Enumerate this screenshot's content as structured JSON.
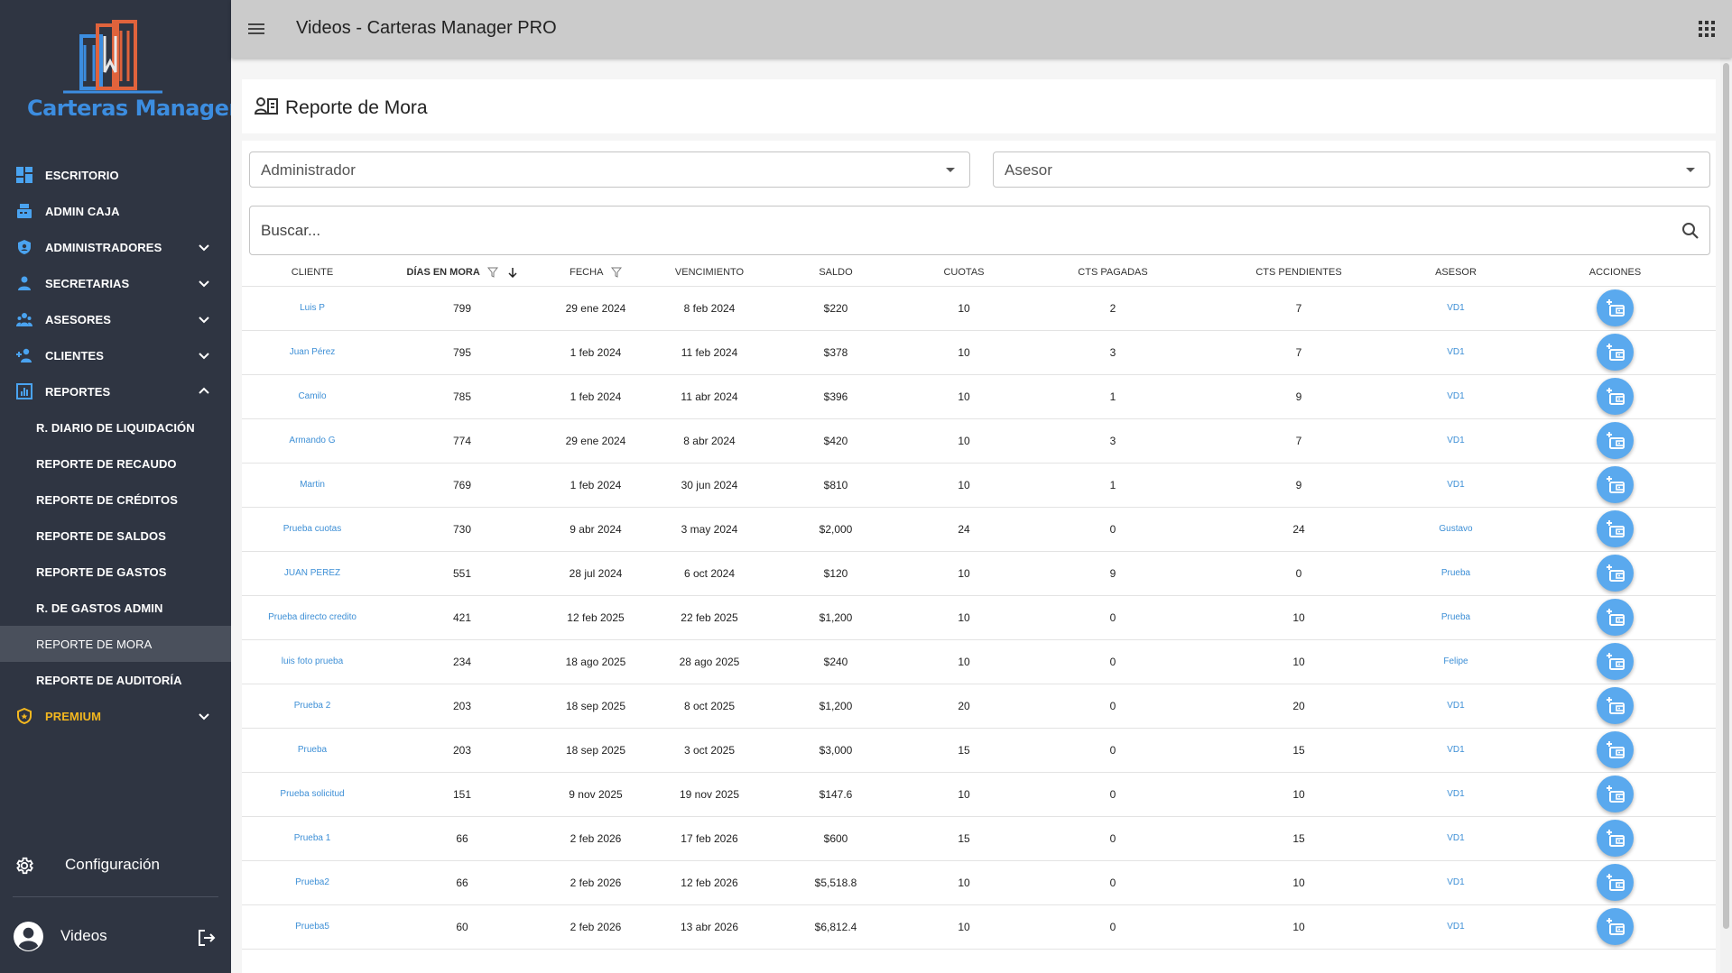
{
  "brand": {
    "logo_text_main": "Carteras Manager",
    "logo_text_accent": "+",
    "logo_colors": {
      "blue": "#3c8de0",
      "orange": "#e0633c"
    }
  },
  "sidebar": {
    "items": [
      {
        "label": "ESCRITORIO",
        "icon": "dashboard-icon"
      },
      {
        "label": "ADMIN CAJA",
        "icon": "cash-register-icon"
      },
      {
        "label": "ADMINISTRADORES",
        "icon": "shield-user-icon",
        "expandable": true
      },
      {
        "label": "SECRETARIAS",
        "icon": "person-icon",
        "expandable": true
      },
      {
        "label": "ASESORES",
        "icon": "people-icon",
        "expandable": true
      },
      {
        "label": "CLIENTES",
        "icon": "person-add-icon",
        "expandable": true
      },
      {
        "label": "REPORTES",
        "icon": "chart-icon",
        "expandable": true,
        "expanded": true
      }
    ],
    "reportes_sub": [
      {
        "label": "R. DIARIO DE LIQUIDACIÓN"
      },
      {
        "label": "REPORTE DE RECAUDO"
      },
      {
        "label": "REPORTE DE CRÉDITOS"
      },
      {
        "label": "REPORTE DE SALDOS"
      },
      {
        "label": "REPORTE DE GASTOS"
      },
      {
        "label": "R. DE GASTOS ADMIN"
      },
      {
        "label": "REPORTE DE MORA",
        "active": true
      },
      {
        "label": "REPORTE DE AUDITORÍA"
      }
    ],
    "premium": {
      "label": "PREMIUM",
      "color": "#f3b71f"
    },
    "config_label": "Configuración",
    "user_name": "Videos"
  },
  "topbar": {
    "title": "Videos - Carteras Manager PRO"
  },
  "page": {
    "title": "Reporte de Mora"
  },
  "filters": {
    "admin_placeholder": "Administrador",
    "asesor_placeholder": "Asesor",
    "search_placeholder": "Buscar..."
  },
  "table": {
    "headers": [
      "CLIENTE",
      "DÍAS EN MORA",
      "FECHA",
      "VENCIMIENTO",
      "SALDO",
      "CUOTAS",
      "CTS PAGADAS",
      "CTS PENDIENTES",
      "ASESOR",
      "ACCIONES"
    ],
    "rows": [
      [
        "Luis P",
        "799",
        "29 ene 2024",
        "8 feb 2024",
        "$220",
        "10",
        "2",
        "7",
        "VD1"
      ],
      [
        "Juan Pérez",
        "795",
        "1 feb 2024",
        "11 feb 2024",
        "$378",
        "10",
        "3",
        "7",
        "VD1"
      ],
      [
        "Camilo",
        "785",
        "1 feb 2024",
        "11 abr 2024",
        "$396",
        "10",
        "1",
        "9",
        "VD1"
      ],
      [
        "Armando G",
        "774",
        "29 ene 2024",
        "8 abr 2024",
        "$420",
        "10",
        "3",
        "7",
        "VD1"
      ],
      [
        "Martin",
        "769",
        "1 feb 2024",
        "30 jun 2024",
        "$810",
        "10",
        "1",
        "9",
        "VD1"
      ],
      [
        "Prueba cuotas",
        "730",
        "9 abr 2024",
        "3 may 2024",
        "$2,000",
        "24",
        "0",
        "24",
        "Gustavo"
      ],
      [
        "JUAN PEREZ",
        "551",
        "28 jul 2024",
        "6 oct 2024",
        "$120",
        "10",
        "9",
        "0",
        "Prueba"
      ],
      [
        "Prueba directo credito",
        "421",
        "12 feb 2025",
        "22 feb 2025",
        "$1,200",
        "10",
        "0",
        "10",
        "Prueba"
      ],
      [
        "luis foto prueba",
        "234",
        "18 ago 2025",
        "28 ago 2025",
        "$240",
        "10",
        "0",
        "10",
        "Felipe"
      ],
      [
        "Prueba 2",
        "203",
        "18 sep 2025",
        "8 oct 2025",
        "$1,200",
        "20",
        "0",
        "20",
        "VD1"
      ],
      [
        "Prueba",
        "203",
        "18 sep 2025",
        "3 oct 2025",
        "$3,000",
        "15",
        "0",
        "15",
        "VD1"
      ],
      [
        "Prueba solicitud",
        "151",
        "9 nov 2025",
        "19 nov 2025",
        "$147.6",
        "10",
        "0",
        "10",
        "VD1"
      ],
      [
        "Prueba 1",
        "66",
        "2 feb 2026",
        "17 feb 2026",
        "$600",
        "15",
        "0",
        "15",
        "VD1"
      ],
      [
        "Prueba2",
        "66",
        "2 feb 2026",
        "12 feb 2026",
        "$5,518.8",
        "10",
        "0",
        "10",
        "VD1"
      ],
      [
        "Prueba5",
        "60",
        "2 feb 2026",
        "13 abr 2026",
        "$6,812.4",
        "10",
        "0",
        "10",
        "VD1"
      ]
    ],
    "sort_column": "DÍAS EN MORA",
    "sort_direction": "desc"
  },
  "colors": {
    "sidebar_bg": "#2f3542",
    "topbar_bg": "#cbcbcb",
    "link": "#3d8fd6",
    "action": "#5aa9ee"
  }
}
